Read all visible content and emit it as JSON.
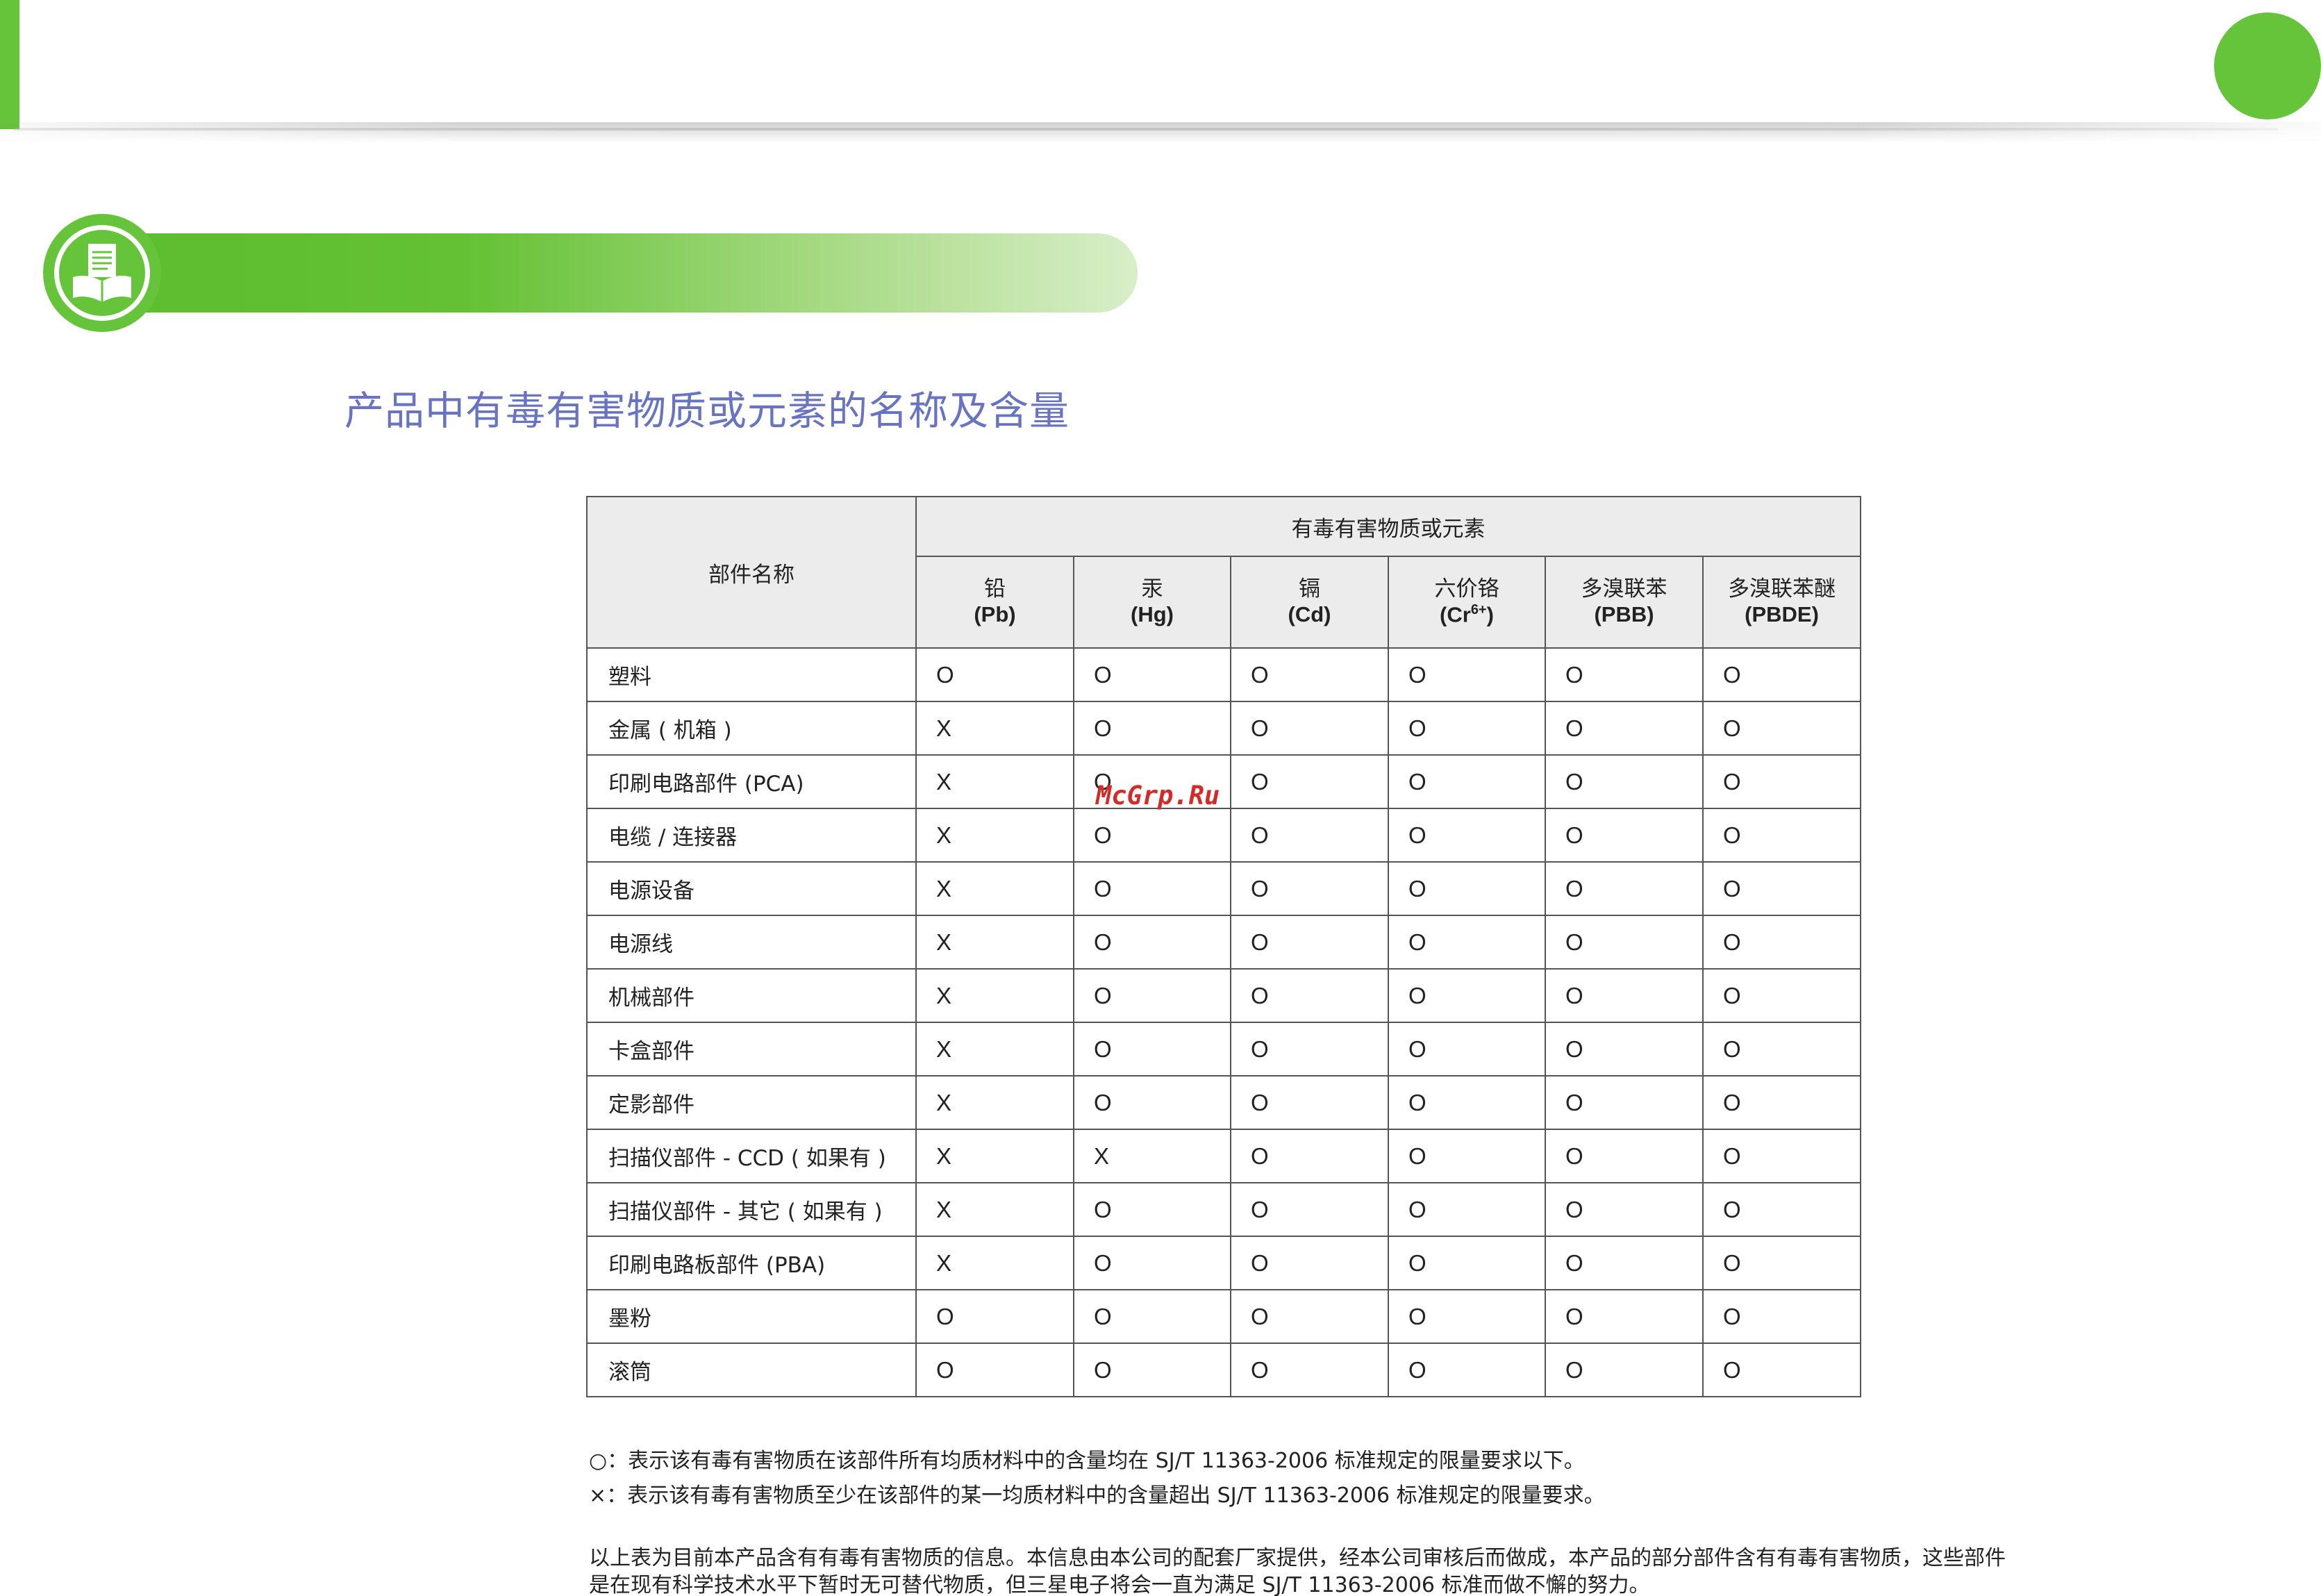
{
  "title": "产品中有毒有害物质或元素的名称及含量",
  "table": {
    "part_header": "部件名称",
    "group_header": "有毒有害物质或元素",
    "columns": [
      {
        "cn": "铅",
        "symbol": "(Pb)"
      },
      {
        "cn": "汞",
        "symbol": "(Hg)"
      },
      {
        "cn": "镉",
        "symbol": "(Cd)"
      },
      {
        "cn": "六价铬",
        "symbol": "(Cr6+)"
      },
      {
        "cn": "多溴联苯",
        "symbol": "(PBB)"
      },
      {
        "cn": "多溴联苯醚",
        "symbol": "(PBDE)"
      }
    ],
    "rows": [
      {
        "part": "塑料",
        "values": [
          "O",
          "O",
          "O",
          "O",
          "O",
          "O"
        ]
      },
      {
        "part": "金属 ( 机箱 )",
        "values": [
          "X",
          "O",
          "O",
          "O",
          "O",
          "O"
        ]
      },
      {
        "part": "印刷电路部件 (PCA)",
        "values": [
          "X",
          "O",
          "O",
          "O",
          "O",
          "O"
        ]
      },
      {
        "part": "电缆 / 连接器",
        "values": [
          "X",
          "O",
          "O",
          "O",
          "O",
          "O"
        ]
      },
      {
        "part": "电源设备",
        "values": [
          "X",
          "O",
          "O",
          "O",
          "O",
          "O"
        ]
      },
      {
        "part": "电源线",
        "values": [
          "X",
          "O",
          "O",
          "O",
          "O",
          "O"
        ]
      },
      {
        "part": "机械部件",
        "values": [
          "X",
          "O",
          "O",
          "O",
          "O",
          "O"
        ]
      },
      {
        "part": "卡盒部件",
        "values": [
          "X",
          "O",
          "O",
          "O",
          "O",
          "O"
        ]
      },
      {
        "part": "定影部件",
        "values": [
          "X",
          "O",
          "O",
          "O",
          "O",
          "O"
        ]
      },
      {
        "part": "扫描仪部件 - CCD ( 如果有 )",
        "values": [
          "X",
          "X",
          "O",
          "O",
          "O",
          "O"
        ]
      },
      {
        "part": "扫描仪部件 - 其它 ( 如果有 )",
        "values": [
          "X",
          "O",
          "O",
          "O",
          "O",
          "O"
        ]
      },
      {
        "part": "印刷电路板部件 (PBA)",
        "values": [
          "X",
          "O",
          "O",
          "O",
          "O",
          "O"
        ]
      },
      {
        "part": "墨粉",
        "values": [
          "O",
          "O",
          "O",
          "O",
          "O",
          "O"
        ]
      },
      {
        "part": "滚筒",
        "values": [
          "O",
          "O",
          "O",
          "O",
          "O",
          "O"
        ]
      }
    ]
  },
  "watermark": "McGrp.Ru",
  "legend": {
    "o": "○：表示该有毒有害物质在该部件所有均质材料中的含量均在 SJ/T 11363-2006 标准规定的限量要求以下。",
    "x": "×：表示该有毒有害物质至少在该部件的某一均质材料中的含量超出 SJ/T 11363-2006 标准规定的限量要求。"
  },
  "footnote": "以上表为目前本产品含有有毒有害物质的信息。本信息由本公司的配套厂家提供，经本公司审核后而做成，本产品的部分部件含有有毒有害物质，这些部件是在现有科学技术水平下暂时无可替代物质，但三星电子将会一直为满足 SJ/T 11363-2006 标准而做不懈的努力。",
  "icons": {
    "badge": "book-document-icon"
  },
  "colors": {
    "accent_green": "#66c43a",
    "title_blue": "#6874c2",
    "header_gray": "#ececec",
    "watermark_red": "#d42a2a"
  }
}
